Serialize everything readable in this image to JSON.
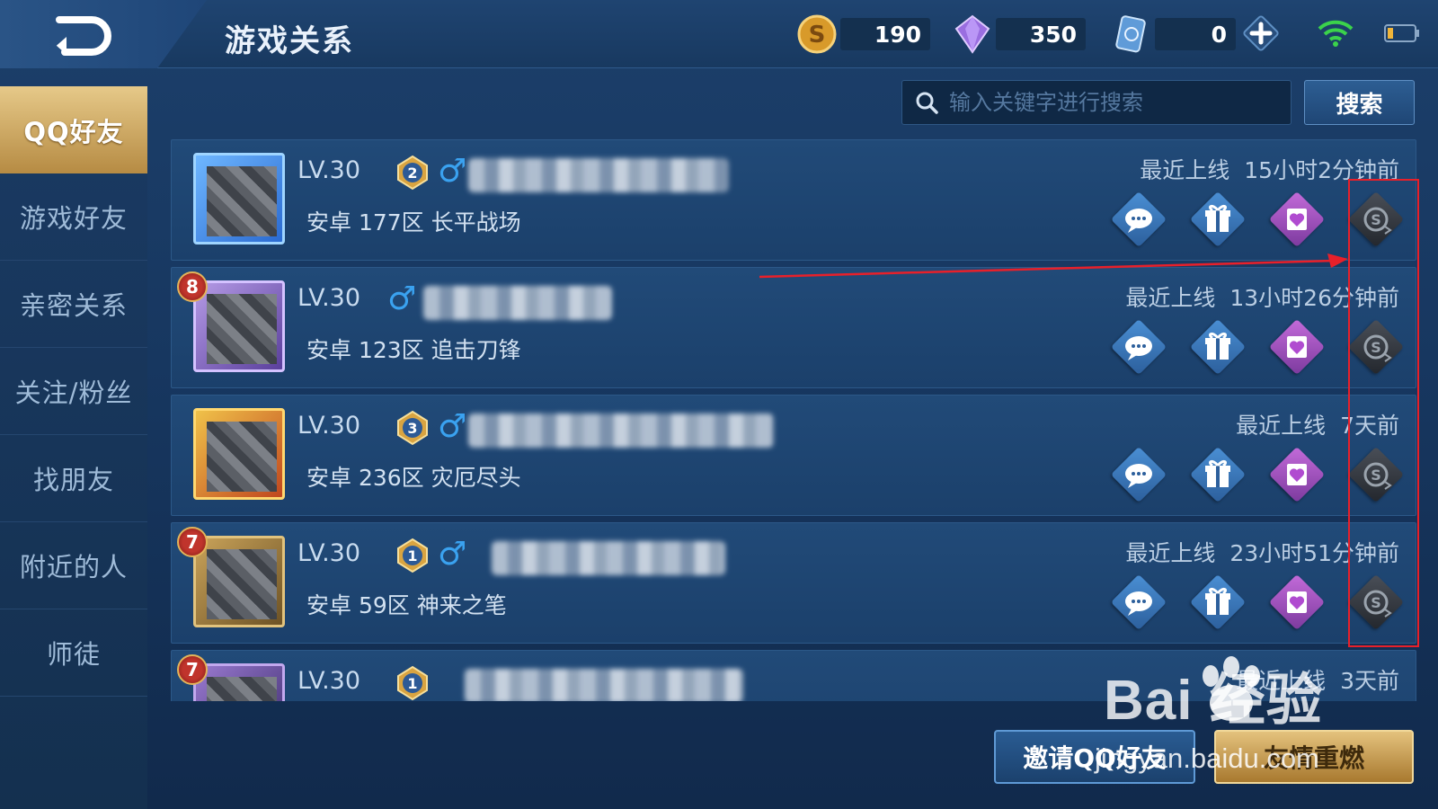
{
  "header": {
    "title": "游戏关系",
    "gold": "190",
    "diamonds": "350",
    "vouchers": "0"
  },
  "sidebar": {
    "items": [
      {
        "label": "QQ好友",
        "active": true
      },
      {
        "label": "游戏好友"
      },
      {
        "label": "亲密关系"
      },
      {
        "label": "关注/粉丝"
      },
      {
        "label": "找朋友"
      },
      {
        "label": "附近的人"
      },
      {
        "label": "师徒"
      }
    ]
  },
  "search": {
    "placeholder": "输入关键字进行搜索",
    "value": "",
    "button_label": "搜索"
  },
  "friends": [
    {
      "level": "LV.30",
      "server": "安卓 177区 长平战场",
      "last_online_label": "最近上线",
      "last_online": "15小时2分钟前",
      "rank": "",
      "tier": "2"
    },
    {
      "level": "LV.30",
      "server": "安卓 123区 追击刀锋",
      "last_online_label": "最近上线",
      "last_online": "13小时26分钟前",
      "rank": "8",
      "tier": ""
    },
    {
      "level": "LV.30",
      "server": "安卓 236区 灾厄尽头",
      "last_online_label": "最近上线",
      "last_online": "7天前",
      "rank": "",
      "tier": "3"
    },
    {
      "level": "LV.30",
      "server": "安卓 59区 神来之笔",
      "last_online_label": "最近上线",
      "last_online": "23小时51分钟前",
      "rank": "7",
      "tier": "1"
    },
    {
      "level": "LV.30",
      "server": "",
      "last_online_label": "最近上线",
      "last_online": "3天前",
      "rank": "7",
      "tier": "1"
    }
  ],
  "bottom": {
    "invite_label": "邀请QQ好友",
    "reignite_label": "友情重燃"
  },
  "watermark": {
    "brand": "Bai  经验",
    "url": "jingyan.baidu.com"
  },
  "icons": {
    "back": "back-arrow-icon",
    "gold": "gold-coin-icon",
    "diamond": "diamond-icon",
    "voucher": "voucher-card-icon",
    "chat": "chat-bubble-icon",
    "gift": "gift-icon",
    "intimacy": "heart-card-icon",
    "reignite": "reignite-coin-icon"
  },
  "colors": {
    "accent_gold": "#d6b26a",
    "annotation_red": "#e8202a",
    "gender_male": "#3aa2f0"
  }
}
